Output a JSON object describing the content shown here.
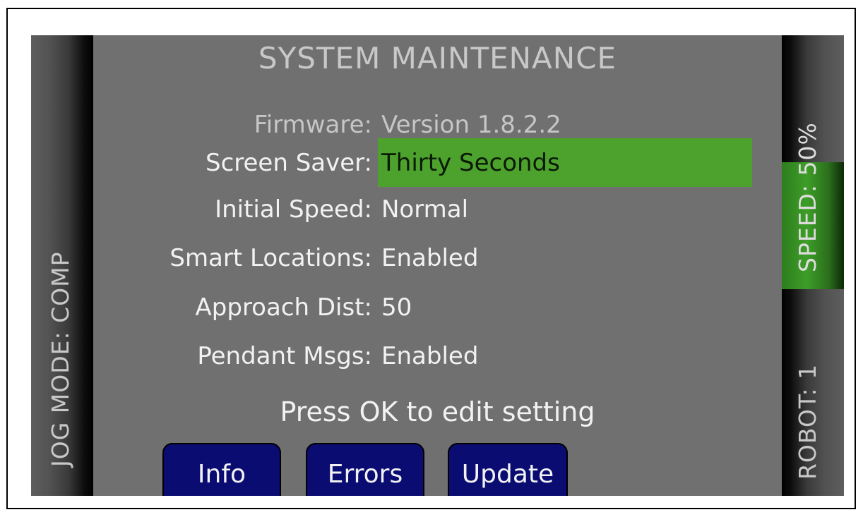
{
  "title": "SYSTEM MAINTENANCE",
  "sidebar_left": {
    "jog_mode": "JOG MODE: COMP"
  },
  "sidebar_right": {
    "speed": "SPEED: 50%",
    "robot": "ROBOT: 1"
  },
  "settings": [
    {
      "label": "Firmware:",
      "value": "Version 1.8.2.2"
    },
    {
      "label": "Screen Saver:",
      "value": "Thirty Seconds"
    },
    {
      "label": "Initial Speed:",
      "value": "Normal"
    },
    {
      "label": "Smart Locations:",
      "value": "Enabled"
    },
    {
      "label": "Approach Dist:",
      "value": "50"
    },
    {
      "label": "Pendant Msgs:",
      "value": "Enabled"
    }
  ],
  "hint": "Press OK to edit setting",
  "buttons": {
    "info": "Info",
    "errors": "Errors",
    "update": "Update"
  },
  "colors": {
    "background": "#707070",
    "highlight": "#4da22e",
    "button": "#0a0c72",
    "speed_active": "#3d9e28"
  }
}
